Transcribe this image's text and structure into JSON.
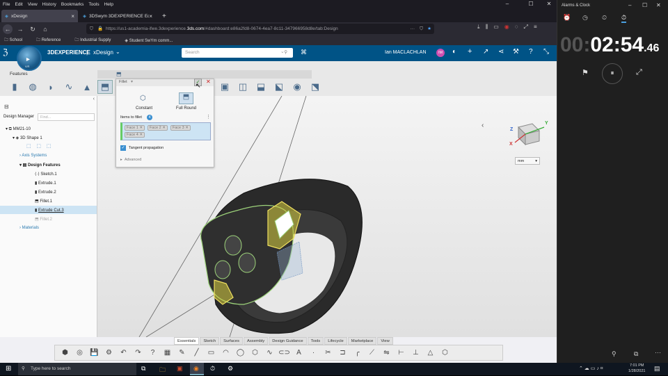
{
  "browser": {
    "menu": [
      "File",
      "Edit",
      "View",
      "History",
      "Bookmarks",
      "Tools",
      "Help"
    ],
    "tabs": [
      {
        "label": "xDesign",
        "active": true
      },
      {
        "label": "3DSwym 3DEXPERIENCE Edu | ...",
        "active": false
      }
    ],
    "url_prefix": "https://us1-academia-ifwe.3dexperience.",
    "url_domain": "3ds.com",
    "url_suffix": "/#dashboard:e86a2fd8-0674-4ea7-8c11-347966958d8e/tab:Design",
    "bookmarks": [
      "School",
      "Reference",
      "Industrial Supply",
      "Student SwYm comm..."
    ]
  },
  "app": {
    "brand": "3DEXPERIENCE",
    "separator": "|",
    "app_name": "xDesign",
    "search_placeholder": "Search",
    "user_name": "Ian MACLACHLAN",
    "user_initials": "IM",
    "compass_version": "V.R"
  },
  "features_tab": "Features",
  "fillet": {
    "title": "Fillet",
    "mode_constant": "Constant",
    "mode_full_round": "Full Round",
    "items_label": "Items to fillet",
    "items_count": "4",
    "faces": [
      "Face 1",
      "Face 2",
      "Face 3",
      "Face 4"
    ],
    "tangent_label": "Tangent propagation",
    "advanced_label": "Advanced"
  },
  "tree": {
    "header": "Design Manager",
    "find_placeholder": "Find...",
    "root": "MM21-10",
    "shape": "3D Shape 1",
    "axis": "Axis Systems",
    "design_features": "Design Features",
    "items": [
      "Sketch.1",
      "Extrude.1",
      "Extrude.2",
      "Fillet.1",
      "Extrude Cut.3",
      "Fillet.2"
    ],
    "materials": "Materials"
  },
  "viewport": {
    "unit": "mm",
    "axis_x": "X",
    "axis_y": "Y",
    "axis_z": "Z"
  },
  "bottom_tabs": [
    "Essentials",
    "Sketch",
    "Surfaces",
    "Assembly",
    "Design Guidance",
    "Tools",
    "Lifecycle",
    "Marketplace",
    "View"
  ],
  "taskbar": {
    "search_placeholder": "Type here to search",
    "time": "7:01 PM",
    "date": "1/28/2021"
  },
  "clock": {
    "title": "Alarms & Clock",
    "dim_hours": "00:",
    "time_main": "02:54",
    "time_fraction": ".46"
  },
  "colors": {
    "header_blue": "#005386",
    "fillet_green": "#9dd37a",
    "highlight_yellow": "#f0e060"
  }
}
